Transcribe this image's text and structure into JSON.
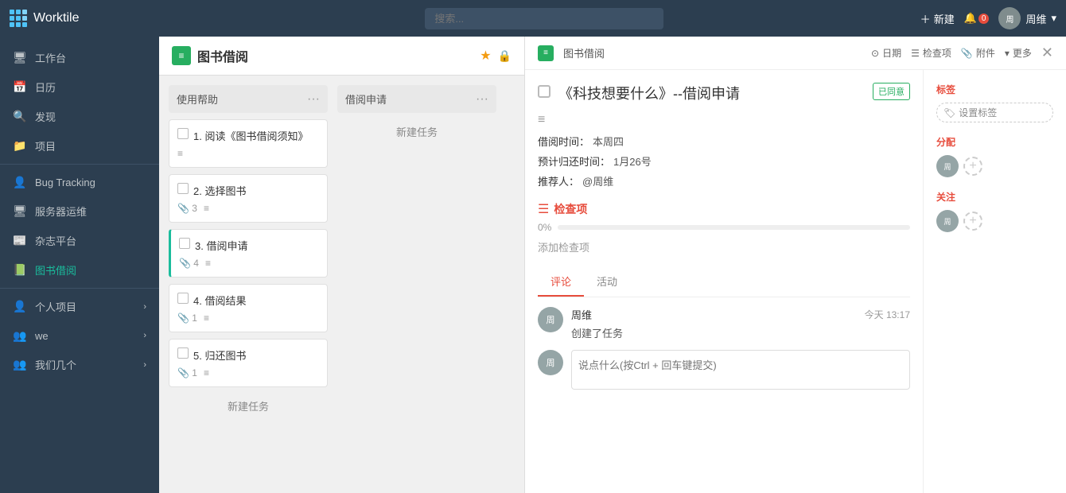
{
  "header": {
    "logo_text": "Worktile",
    "search_placeholder": "搜索...",
    "new_btn_label": "新建",
    "notif_label": "",
    "notif_count": "0",
    "user_name": "周维",
    "user_arrow": "▾"
  },
  "sidebar": {
    "items": [
      {
        "id": "workbench",
        "icon": "🖥",
        "label": "工作台",
        "arrow": ""
      },
      {
        "id": "calendar",
        "icon": "📅",
        "label": "日历",
        "arrow": ""
      },
      {
        "id": "discover",
        "icon": "🔍",
        "label": "发现",
        "arrow": ""
      },
      {
        "id": "projects",
        "icon": "📁",
        "label": "项目",
        "arrow": ""
      },
      {
        "id": "bugtracking",
        "icon": "👤",
        "label": "Bug Tracking",
        "arrow": ""
      },
      {
        "id": "serverops",
        "icon": "🖥",
        "label": "服务器运维",
        "arrow": ""
      },
      {
        "id": "magazine",
        "icon": "📰",
        "label": "杂志平台",
        "arrow": ""
      },
      {
        "id": "library",
        "icon": "📗",
        "label": "图书借阅",
        "arrow": "",
        "active": true
      },
      {
        "id": "personal",
        "icon": "👤",
        "label": "个人项目",
        "arrow": "›"
      },
      {
        "id": "we",
        "icon": "👥",
        "label": "we",
        "arrow": "›"
      },
      {
        "id": "ourteam",
        "icon": "👥",
        "label": "我们几个",
        "arrow": "›"
      }
    ]
  },
  "project": {
    "icon": "≡",
    "title": "图书借阅",
    "star": "★",
    "lock": "🔒"
  },
  "lists": [
    {
      "id": "help",
      "title": "使用帮助",
      "tasks": [
        {
          "id": 1,
          "name": "1. 阅读《图书借阅须知》",
          "attachments": "",
          "notes": ""
        },
        {
          "id": 2,
          "name": "2. 选择图书",
          "attachments": "3",
          "notes": "≡"
        },
        {
          "id": 3,
          "name": "3. 借阅申请",
          "attachments": "4",
          "notes": "≡"
        },
        {
          "id": 4,
          "name": "4. 借阅结果",
          "attachments": "1",
          "notes": "≡"
        },
        {
          "id": 5,
          "name": "5. 归还图书",
          "attachments": "1",
          "notes": "≡"
        }
      ],
      "new_task": "新建任务"
    },
    {
      "id": "borrow",
      "title": "借阅申请",
      "tasks": [],
      "new_task": "新建任务"
    }
  ],
  "detail": {
    "proj_icon": "≡",
    "proj_name": "图书借阅",
    "actions": {
      "date": "日期",
      "checklist": "检查项",
      "attachment": "附件",
      "more": "更多"
    },
    "task_title": "《科技想要什么》--借阅申请",
    "status_badge": "已同意",
    "desc_icon": "≡",
    "borrow_time_label": "借阅时间：",
    "borrow_time_value": "本周四",
    "return_time_label": "预计归还时间：",
    "return_time_value": "1月26号",
    "recommender_label": "推荐人：",
    "recommender_value": "@周维",
    "checklist_title": "检查项",
    "progress_label": "0%",
    "progress_value": 0,
    "add_checklist": "添加检查项",
    "tabs": [
      {
        "id": "comments",
        "label": "评论",
        "active": true
      },
      {
        "id": "activity",
        "label": "活动",
        "active": false
      }
    ],
    "comment": {
      "user": "周维",
      "time": "今天 13:17",
      "text": "创建了任务"
    },
    "comment_placeholder": "说点什么(按Ctrl + 回车键提交)",
    "sidebar": {
      "tags_label": "标签",
      "tags_btn": "设置标签",
      "assign_label": "分配",
      "follow_label": "关注"
    }
  }
}
